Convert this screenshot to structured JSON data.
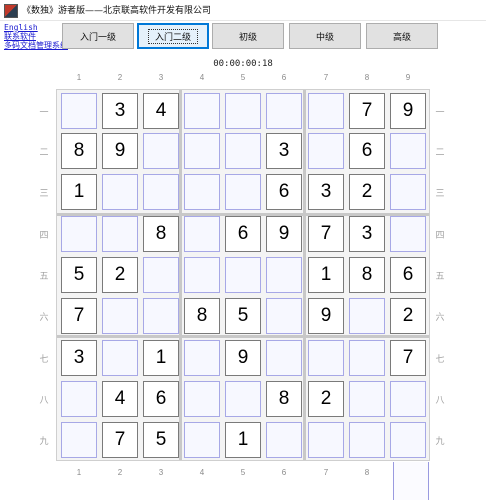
{
  "window": {
    "title": "《数独》游者版——北京联高软件开发有限公司",
    "icon": "sudoku-app-icon"
  },
  "links": {
    "english": "English",
    "contact": "联系软件",
    "doc_system": "多码文档管理系统"
  },
  "levels": [
    {
      "label": "入门一级",
      "active": false
    },
    {
      "label": "入门二级",
      "active": true
    },
    {
      "label": "初级",
      "active": false
    },
    {
      "label": "中级",
      "active": false
    },
    {
      "label": "高级",
      "active": false
    }
  ],
  "timer": "00:00:00:18",
  "column_numbers": [
    "1",
    "2",
    "3",
    "4",
    "5",
    "6",
    "7",
    "8",
    "9"
  ],
  "row_labels": [
    "一",
    "二",
    "三",
    "四",
    "五",
    "六",
    "七",
    "八",
    "九"
  ],
  "grid": [
    [
      "",
      "3",
      "4",
      "",
      "",
      "",
      "",
      "7",
      "9"
    ],
    [
      "8",
      "9",
      "",
      "",
      "",
      "3",
      "",
      "6",
      ""
    ],
    [
      "1",
      "",
      "",
      "",
      "",
      "6",
      "3",
      "2",
      ""
    ],
    [
      "",
      "",
      "8",
      "",
      "6",
      "9",
      "7",
      "3",
      ""
    ],
    [
      "5",
      "2",
      "",
      "",
      "",
      "",
      "1",
      "8",
      "6"
    ],
    [
      "7",
      "",
      "",
      "8",
      "5",
      "",
      "9",
      "",
      "2"
    ],
    [
      "3",
      "",
      "1",
      "",
      "9",
      "",
      "",
      "",
      "7"
    ],
    [
      "",
      "4",
      "6",
      "",
      "",
      "8",
      "2",
      "",
      ""
    ],
    [
      "",
      "7",
      "5",
      "",
      "1",
      "",
      "",
      "",
      ""
    ]
  ],
  "colors": {
    "empty_cell_border": "#a7a8e6",
    "given_cell_border": "#7a7a7a",
    "active_button_border": "#0078d7"
  }
}
